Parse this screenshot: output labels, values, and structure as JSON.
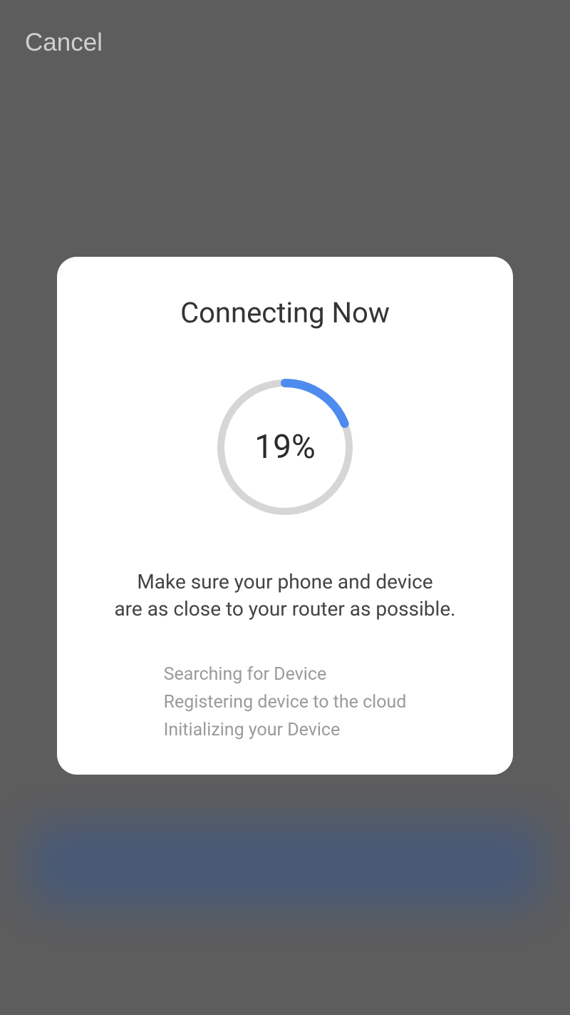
{
  "header": {
    "cancel_label": "Cancel"
  },
  "modal": {
    "title": "Connecting Now",
    "progress_percent": 19,
    "progress_label": "19%",
    "instruction_line1": "Make sure your phone and device",
    "instruction_line2": "are as close to your router as possible.",
    "status_steps": [
      "Searching for Device",
      "Registering device to the cloud",
      "Initializing your Device"
    ]
  },
  "colors": {
    "accent": "#4d8bef",
    "background_dim": "#5d5d5d",
    "card_bg": "#ffffff"
  }
}
